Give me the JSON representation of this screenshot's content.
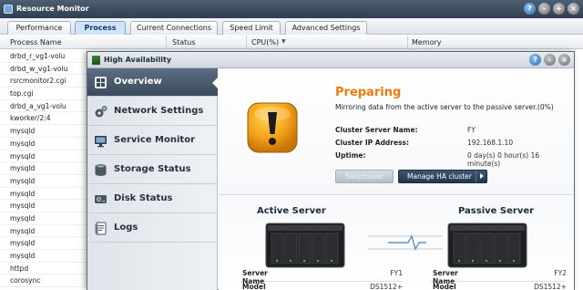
{
  "resource_monitor": {
    "title": "Resource Monitor",
    "tabs": [
      "Performance",
      "Process",
      "Current Connections",
      "Speed Limit",
      "Advanced Settings"
    ],
    "active_tab": "Process",
    "columns": [
      "Process Name",
      "Status",
      "CPU(%)",
      "Memory"
    ],
    "processes": [
      "drbd_r_vg1-volu",
      "drbd_w_vg1-volu",
      "rsrcmonitor2.cgi",
      "top.cgi",
      "drbd_a_vg1-volu",
      "kworker/2:4",
      "mysqld",
      "mysqld",
      "mysqld",
      "mysqld",
      "mysqld",
      "mysqld",
      "mysqld",
      "mysqld",
      "mysqld",
      "mysqld",
      "mysqld",
      "httpd",
      "corosync"
    ]
  },
  "high_availability": {
    "title": "High Availability",
    "nav": [
      {
        "label": "Overview",
        "icon": "overview-icon",
        "active": true
      },
      {
        "label": "Network Settings",
        "icon": "gears-icon",
        "active": false
      },
      {
        "label": "Service Monitor",
        "icon": "monitor-icon",
        "active": false
      },
      {
        "label": "Storage Status",
        "icon": "storage-icon",
        "active": false
      },
      {
        "label": "Disk Status",
        "icon": "disk-icon",
        "active": false
      },
      {
        "label": "Logs",
        "icon": "logs-icon",
        "active": false
      }
    ],
    "status": {
      "title": "Preparing",
      "description": "Mirroring data from the active server to the passive server.(0%)",
      "progress_percent": 0,
      "color": "#f07a10"
    },
    "cluster": {
      "name_label": "Cluster Server Name:",
      "name_value": "FY",
      "ip_label": "Cluster IP Address:",
      "ip_value": "192.168.1.10",
      "uptime_label": "Uptime:",
      "uptime_value": "0 day(s) 0 hour(s) 16 minute(s)"
    },
    "buttons": {
      "switchover": "Switchover",
      "manage": "Manage HA cluster"
    },
    "active_server": {
      "heading": "Active Server",
      "server_name_label": "Server Name",
      "server_name": "FY1",
      "model_name_label": "Model Name",
      "model_name": "DS1512+"
    },
    "passive_server": {
      "heading": "Passive Server",
      "server_name_label": "Server Name",
      "server_name": "FY2",
      "model_name_label": "Model Name",
      "model_name": "DS1512+"
    }
  },
  "window_buttons": {
    "help": "?"
  }
}
